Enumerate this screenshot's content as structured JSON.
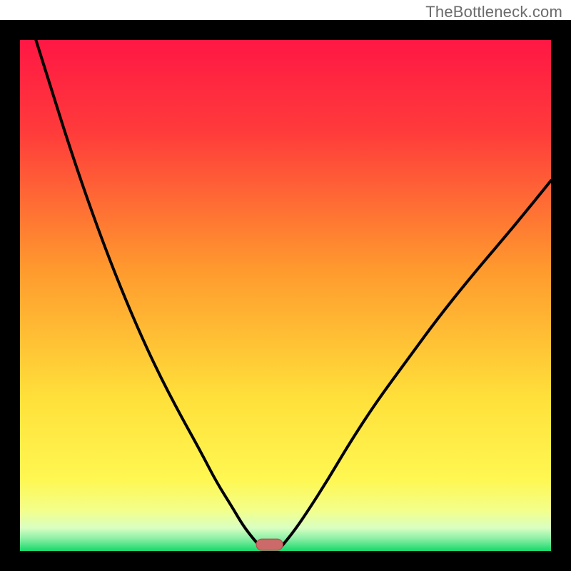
{
  "watermark": "TheBottleneck.com",
  "colors": {
    "frame": "#000000",
    "curve": "#000000",
    "marker_fill": "#cc6a6a",
    "marker_stroke": "#b05252",
    "gradient_stops": [
      {
        "offset": 0.0,
        "color": "#ff1744"
      },
      {
        "offset": 0.18,
        "color": "#ff3b3b"
      },
      {
        "offset": 0.45,
        "color": "#ff9a2e"
      },
      {
        "offset": 0.7,
        "color": "#ffe03a"
      },
      {
        "offset": 0.86,
        "color": "#fff752"
      },
      {
        "offset": 0.92,
        "color": "#f3ff8a"
      },
      {
        "offset": 0.955,
        "color": "#d9ffc2"
      },
      {
        "offset": 0.975,
        "color": "#8ef0a6"
      },
      {
        "offset": 1.0,
        "color": "#17d86b"
      }
    ]
  },
  "chart_data": {
    "type": "line",
    "title": "",
    "xlabel": "",
    "ylabel": "",
    "xlim": [
      0,
      100
    ],
    "ylim": [
      0,
      100
    ],
    "series": [
      {
        "name": "left-curve",
        "x": [
          3,
          6,
          10,
          14,
          18,
          22,
          26,
          30,
          34,
          37,
          40,
          42,
          44,
          45.5
        ],
        "y": [
          100,
          90,
          77,
          65,
          54,
          44,
          35,
          27,
          19.5,
          13.5,
          8.5,
          5,
          2.3,
          0.6
        ]
      },
      {
        "name": "right-curve",
        "x": [
          49,
          51,
          54,
          58,
          62,
          67,
          73,
          79,
          86,
          93,
          100
        ],
        "y": [
          0.6,
          3,
          7.5,
          14,
          21,
          29,
          37.5,
          46,
          55,
          63.5,
          72.5
        ]
      }
    ],
    "marker": {
      "x_center": 47,
      "width": 5,
      "height": 2.2
    }
  }
}
